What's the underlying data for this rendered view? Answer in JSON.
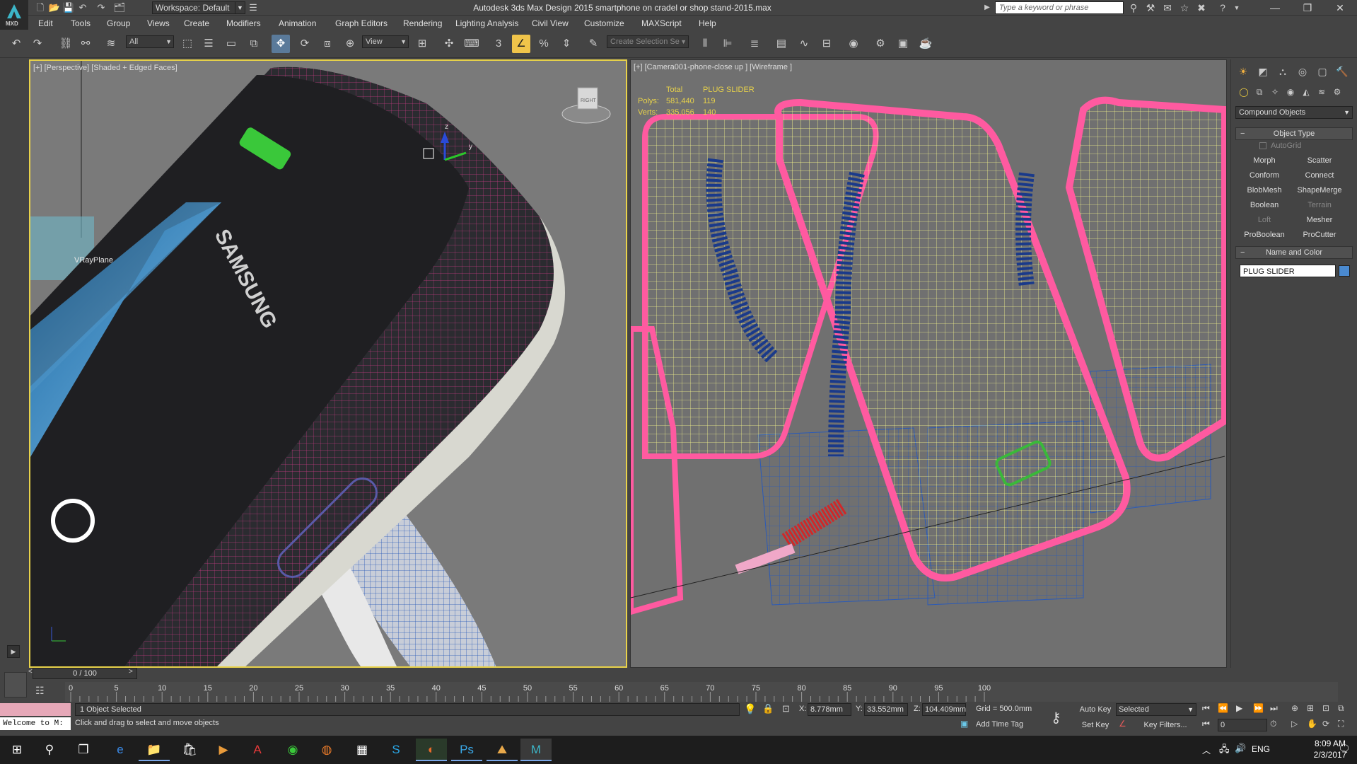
{
  "titlebar": {
    "workspace": "Workspace: Default",
    "title": "Autodesk 3ds Max Design 2015      smartphone on cradel or shop stand-2015.max",
    "search_placeholder": "Type a keyword or phrase",
    "logo_sub": "MXD"
  },
  "menu": [
    "Edit",
    "Tools",
    "Group",
    "Views",
    "Create",
    "Modifiers",
    "Animation",
    "Graph Editors",
    "Rendering",
    "Lighting Analysis",
    "Civil View",
    "Customize",
    "MAXScript",
    "Help"
  ],
  "toolbar": {
    "filter": "All",
    "refcoord": "View",
    "selection_set_placeholder": "Create Selection Se"
  },
  "viewport_left": {
    "label": "[+] [Perspective] [Shaded + Edged Faces]",
    "object_label": "VRayPlane",
    "brand_text": "SAMSUNG",
    "viewcube_label": "RIGHT",
    "gizmo_z": "z",
    "gizmo_y": "y"
  },
  "viewport_right": {
    "label": "[+] [Camera001-phone-close up ] [Wireframe ]",
    "stats": {
      "header_total": "Total",
      "header_sel": "PLUG SLIDER",
      "polys_label": "Polys:",
      "polys_total": "581,440",
      "polys_sel": "119",
      "verts_label": "Verts:",
      "verts_total": "335,056",
      "verts_sel": "140"
    }
  },
  "command_panel": {
    "category": "Compound Objects",
    "object_type_title": "Object Type",
    "autogrid": "AutoGrid",
    "buttons": [
      {
        "label": "Morph",
        "enabled": true
      },
      {
        "label": "Scatter",
        "enabled": true
      },
      {
        "label": "Conform",
        "enabled": true
      },
      {
        "label": "Connect",
        "enabled": true
      },
      {
        "label": "BlobMesh",
        "enabled": true
      },
      {
        "label": "ShapeMerge",
        "enabled": true
      },
      {
        "label": "Boolean",
        "enabled": true
      },
      {
        "label": "Terrain",
        "enabled": false
      },
      {
        "label": "Loft",
        "enabled": false
      },
      {
        "label": "Mesher",
        "enabled": true
      },
      {
        "label": "ProBoolean",
        "enabled": true
      },
      {
        "label": "ProCutter",
        "enabled": true
      }
    ],
    "name_color_title": "Name and Color",
    "object_name": "PLUG SLIDER",
    "object_color": "#4a8ad0"
  },
  "timeline": {
    "slider": "0 / 100",
    "ticks": [
      "0",
      "5",
      "10",
      "15",
      "20",
      "25",
      "30",
      "35",
      "40",
      "45",
      "50",
      "55",
      "60",
      "65",
      "70",
      "75",
      "80",
      "85",
      "90",
      "95",
      "100"
    ]
  },
  "status": {
    "selection": "1 Object Selected",
    "prompt": "Click and drag to select and move objects",
    "maxscript": "Welcome to M:",
    "x_label": "X:",
    "x": "8.778mm",
    "y_label": "Y:",
    "y": "33.552mm",
    "z_label": "Z:",
    "z": "104.409mm",
    "grid": "Grid = 500.0mm",
    "add_time_tag": "Add Time Tag",
    "auto_key": "Auto Key",
    "set_key": "Set Key",
    "key_mode": "Selected",
    "key_filters": "Key Filters...",
    "frame": "0"
  },
  "taskbar": {
    "lang": "ENG",
    "time": "8:09 AM",
    "date": "2/3/2017"
  },
  "colors": {
    "selection_pink": "#ff5aa0",
    "wire_blue": "#2a5ab8",
    "wire_yellow": "#f0f08a",
    "wire_red": "#d02828",
    "wire_green": "#3ab83a",
    "active_border": "#e8d24a"
  }
}
